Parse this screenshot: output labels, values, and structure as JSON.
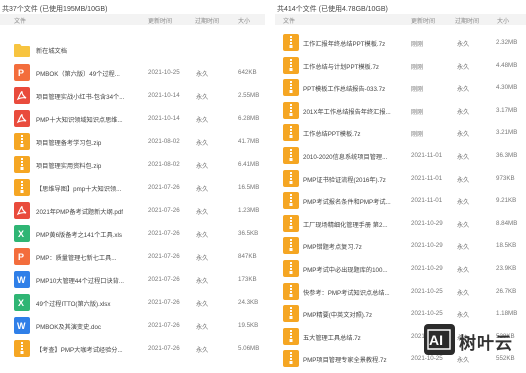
{
  "left": {
    "summary": "共37个文件 (已使用195MB/10GB)",
    "columns": {
      "name": "文件",
      "date": "更新时间",
      "expiry": "过期时间",
      "size": "大小"
    },
    "rows": [
      {
        "icon": "folder-icon",
        "name": "新在城文档",
        "date": "",
        "expiry": "",
        "size": ""
      },
      {
        "icon": "ppt-icon",
        "name": "PMBOK（第六版）49个过程...",
        "date": "2021-10-25",
        "expiry": "永久",
        "size": "642KB"
      },
      {
        "icon": "pdf-icon",
        "name": "项目管理实战小红书-包含34个...",
        "date": "2021-10-14",
        "expiry": "永久",
        "size": "2.55MB"
      },
      {
        "icon": "pdf-icon",
        "name": "PMP十大知识领域知识点思维...",
        "date": "2021-10-14",
        "expiry": "永久",
        "size": "6.28MB"
      },
      {
        "icon": "zip-icon",
        "name": "项目管理备考学习包.zip",
        "date": "2021-08-02",
        "expiry": "永久",
        "size": "41.7MB"
      },
      {
        "icon": "zip-icon",
        "name": "项目管理实用资料包.zip",
        "date": "2021-08-02",
        "expiry": "永久",
        "size": "6.41MB"
      },
      {
        "icon": "zip-icon",
        "name": "【思维导图】pmp十大知识领...",
        "date": "2021-07-26",
        "expiry": "永久",
        "size": "16.5MB"
      },
      {
        "icon": "pdf-icon",
        "name": "2021年PMP备考试题新大纲.pdf",
        "date": "2021-07-26",
        "expiry": "永久",
        "size": "1.23MB"
      },
      {
        "icon": "xls-icon",
        "name": "PMP黄6版备考之141个工具.xls",
        "date": "2021-07-26",
        "expiry": "永久",
        "size": "36.5KB"
      },
      {
        "icon": "ppt-icon",
        "name": "PMP：质量管理七新七工具...",
        "date": "2021-07-26",
        "expiry": "永久",
        "size": "847KB"
      },
      {
        "icon": "doc-icon",
        "name": "PMP10大管理44个过程口诀背...",
        "date": "2021-07-26",
        "expiry": "永久",
        "size": "173KB"
      },
      {
        "icon": "xls-icon",
        "name": "49个过程ITTO(第六版).xlsx",
        "date": "2021-07-26",
        "expiry": "永久",
        "size": "24.3KB"
      },
      {
        "icon": "doc-icon",
        "name": "PMBOK及其演变史.doc",
        "date": "2021-07-26",
        "expiry": "永久",
        "size": "19.5KB"
      },
      {
        "icon": "zip-icon",
        "name": "【考查】PMP大咖考试经验分...",
        "date": "2021-07-26",
        "expiry": "永久",
        "size": "5.06MB"
      }
    ]
  },
  "right": {
    "summary": "共414个文件 (已使用4.78GB/10GB)",
    "columns": {
      "name": "文件",
      "date": "更新时间",
      "expiry": "过期时间",
      "size": "大小"
    },
    "rows": [
      {
        "icon": "zip-icon",
        "name": "工作汇报年终总结PPT模板.7z",
        "date": "刚刚",
        "expiry": "永久",
        "size": "2.32MB"
      },
      {
        "icon": "zip-icon",
        "name": "工作总结与计划PPT模板.7z",
        "date": "刚刚",
        "expiry": "永久",
        "size": "4.48MB"
      },
      {
        "icon": "zip-icon",
        "name": "PPT模板工作总结报告-033.7z",
        "date": "刚刚",
        "expiry": "永久",
        "size": "4.30MB"
      },
      {
        "icon": "zip-icon",
        "name": "201X年工作总结报告年终汇报...",
        "date": "刚刚",
        "expiry": "永久",
        "size": "3.17MB"
      },
      {
        "icon": "zip-icon",
        "name": "工作总结PPT模板.7z",
        "date": "刚刚",
        "expiry": "永久",
        "size": "3.21MB"
      },
      {
        "icon": "zip-icon",
        "name": "2010-2020信息系统项目管理...",
        "date": "2021-11-01",
        "expiry": "永久",
        "size": "36.3MB"
      },
      {
        "icon": "zip-icon",
        "name": "PMP证书验证流程(2016年).7z",
        "date": "2021-11-01",
        "expiry": "永久",
        "size": "973KB"
      },
      {
        "icon": "zip-icon",
        "name": "PMP考试报名条件和PMP考试...",
        "date": "2021-11-01",
        "expiry": "永久",
        "size": "9.21KB"
      },
      {
        "icon": "zip-icon",
        "name": "工厂现场精细化管理手册  第2...",
        "date": "2021-10-29",
        "expiry": "永久",
        "size": "8.84MB"
      },
      {
        "icon": "zip-icon",
        "name": "PMP错题考点复习.7z",
        "date": "2021-10-29",
        "expiry": "永久",
        "size": "18.5KB"
      },
      {
        "icon": "zip-icon",
        "name": "PMP考试中必出现题库的100...",
        "date": "2021-10-29",
        "expiry": "永久",
        "size": "23.9KB"
      },
      {
        "icon": "zip-icon",
        "name": "快参考：PMP考试知识点总结...",
        "date": "2021-10-25",
        "expiry": "永久",
        "size": "26.7KB"
      },
      {
        "icon": "zip-icon",
        "name": "PMP精要(中英文对照).7z",
        "date": "2021-10-25",
        "expiry": "永久",
        "size": "1.18MB"
      },
      {
        "icon": "zip-icon",
        "name": "五大管理工具总结.7z",
        "date": "2021-10-25",
        "expiry": "永久",
        "size": "528KB"
      },
      {
        "icon": "zip-icon",
        "name": "PMP项目管理专家全景教程.7z",
        "date": "2021-10-25",
        "expiry": "永久",
        "size": "552KB"
      }
    ]
  },
  "watermark": {
    "logo_text": "AI",
    "brand": "树叶云"
  },
  "colors": {
    "folder": "#f7c440",
    "ppt": "#f36d3c",
    "pdf": "#e94b3c",
    "zip": "#f5a623",
    "xls": "#2fb574",
    "doc": "#2f7fe8",
    "header_bg": "#f3f3f3"
  }
}
